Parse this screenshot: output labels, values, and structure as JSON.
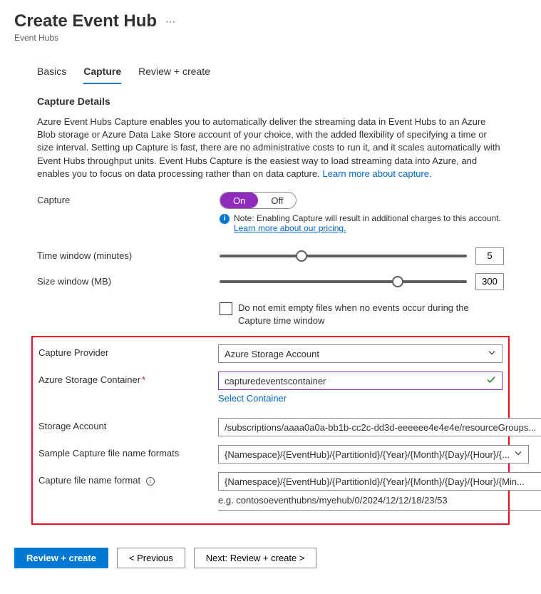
{
  "header": {
    "title": "Create Event Hub",
    "subtitle": "Event Hubs"
  },
  "tabs": [
    {
      "label": "Basics",
      "active": false
    },
    {
      "label": "Capture",
      "active": true
    },
    {
      "label": "Review + create",
      "active": false
    }
  ],
  "section": {
    "title": "Capture Details",
    "description": "Azure Event Hubs Capture enables you to automatically deliver the streaming data in Event Hubs to an Azure Blob storage or Azure Data Lake Store account of your choice, with the added flexibility of specifying a time or size interval. Setting up Capture is fast, there are no administrative costs to run it, and it scales automatically with Event Hubs throughput units. Event Hubs Capture is the easiest way to load streaming data into Azure, and enables you to focus on data processing rather than on data capture. ",
    "learn_more_link": "Learn more about capture."
  },
  "capture": {
    "label": "Capture",
    "toggle_on": "On",
    "toggle_off": "Off",
    "info_note": "Note: Enabling Capture will result in additional charges to this account. ",
    "pricing_link": "Learn more about our pricing."
  },
  "time_window": {
    "label": "Time window (minutes)",
    "value": "5",
    "thumb_position": "33%"
  },
  "size_window": {
    "label": "Size window (MB)",
    "value": "300",
    "thumb_position": "72%"
  },
  "empty_files": {
    "label": "Do not emit empty files when no events occur during the Capture time window"
  },
  "provider": {
    "label": "Capture Provider",
    "value": "Azure Storage Account"
  },
  "container": {
    "label": "Azure Storage Container",
    "value": "capturedeventscontainer",
    "select_link": "Select Container"
  },
  "storage_account": {
    "label": "Storage Account",
    "value": "/subscriptions/aaaa0a0a-bb1b-cc2c-dd3d-eeeeee4e4e4e/resourceGroups..."
  },
  "sample_formats": {
    "label": "Sample Capture file name formats",
    "value": "{Namespace}/{EventHub}/{PartitionId}/{Year}/{Month}/{Day}/{Hour}/{..."
  },
  "file_format": {
    "label": "Capture file name format",
    "value": "{Namespace}/{EventHub}/{PartitionId}/{Year}/{Month}/{Day}/{Hour}/{Min...",
    "example": "e.g. contosoeventhubns/myehub/0/2024/12/12/18/23/53"
  },
  "buttons": {
    "review_create": "Review + create",
    "previous": "< Previous",
    "next": "Next: Review + create >"
  }
}
